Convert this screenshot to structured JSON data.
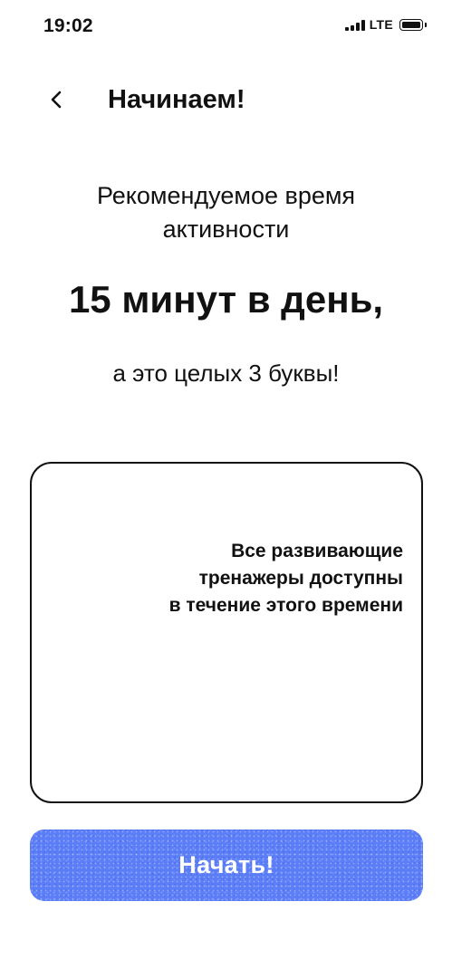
{
  "status_bar": {
    "time": "19:02",
    "network": "LTE",
    "icons": [
      "signal-icon",
      "battery-icon"
    ]
  },
  "header": {
    "back_icon": "chevron-left-icon",
    "title": "Начинаем!"
  },
  "main": {
    "subtitle_line1": "Рекомендуемое время",
    "subtitle_line2": "активности",
    "headline": "15 минут в день,",
    "tagline": "а это целых 3 буквы!"
  },
  "info_card": {
    "text": "Все развивающие\nтренажеры доступны\nв течение этого времени"
  },
  "actions": {
    "start_label": "Начать!"
  },
  "colors": {
    "accent": "#5b7df7",
    "text": "#111111",
    "background": "#ffffff"
  }
}
